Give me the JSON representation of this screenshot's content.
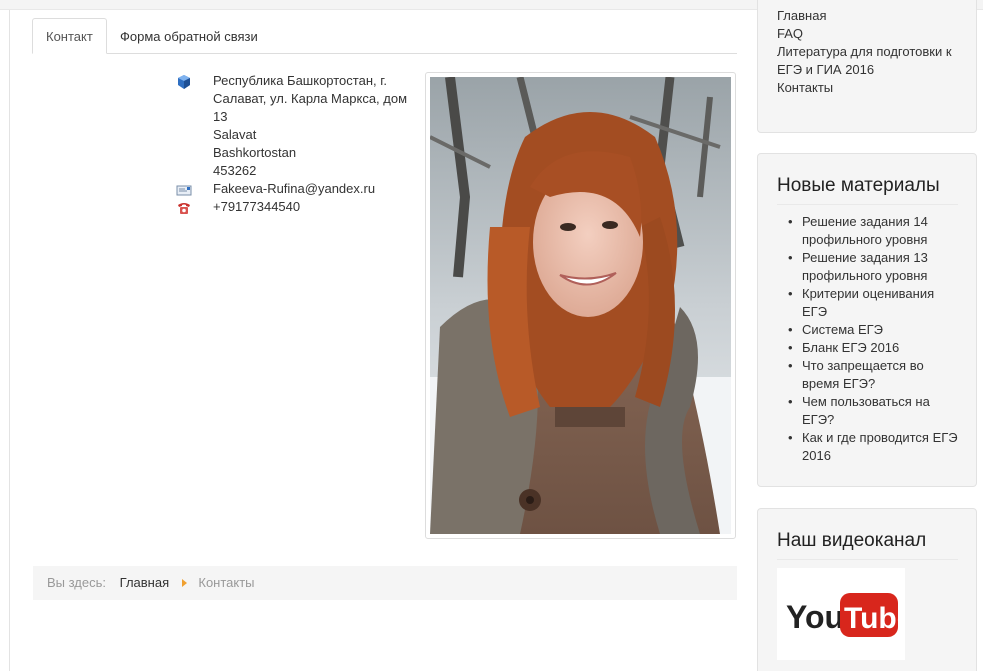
{
  "tabs": [
    {
      "label": "Контакт"
    },
    {
      "label": "Форма обратной связи"
    }
  ],
  "contact": {
    "address_lines": [
      "Республика Башкортостан, г.",
      "Салават, ул. Карла Маркса, дом",
      "13"
    ],
    "city": "Salavat",
    "region": "Bashkortostan",
    "postcode": "453262",
    "email": "Fakeeva-Rufina@yandex.ru",
    "phone": "+79177344540"
  },
  "breadcrumb": {
    "label": "Вы здесь:",
    "home": "Главная",
    "current": "Контакты"
  },
  "sidebar": {
    "menu": [
      {
        "label": "Главная"
      },
      {
        "label": "FAQ"
      },
      {
        "label": "Литература для подготовки к ЕГЭ и ГИА 2016"
      },
      {
        "label": "Контакты"
      }
    ],
    "new_materials": {
      "title": "Новые материалы",
      "items": [
        {
          "label": "Решение задания 14 профильного уровня"
        },
        {
          "label": "Решение задания 13 профильного уровня"
        },
        {
          "label": "Критерии оценивания ЕГЭ"
        },
        {
          "label": "Система ЕГЭ"
        },
        {
          "label": "Бланк ЕГЭ 2016"
        },
        {
          "label": "Что запрещается во время ЕГЭ?"
        },
        {
          "label": "Чем пользоваться на ЕГЭ?"
        },
        {
          "label": "Как и где проводится ЕГЭ 2016"
        }
      ]
    },
    "video": {
      "title": "Наш видеоканал",
      "logo_you": "You",
      "logo_tube": "Tube"
    }
  },
  "colors": {
    "youtube_red": "#d8261c",
    "breadcrumb_arrow": "#f0a030"
  }
}
